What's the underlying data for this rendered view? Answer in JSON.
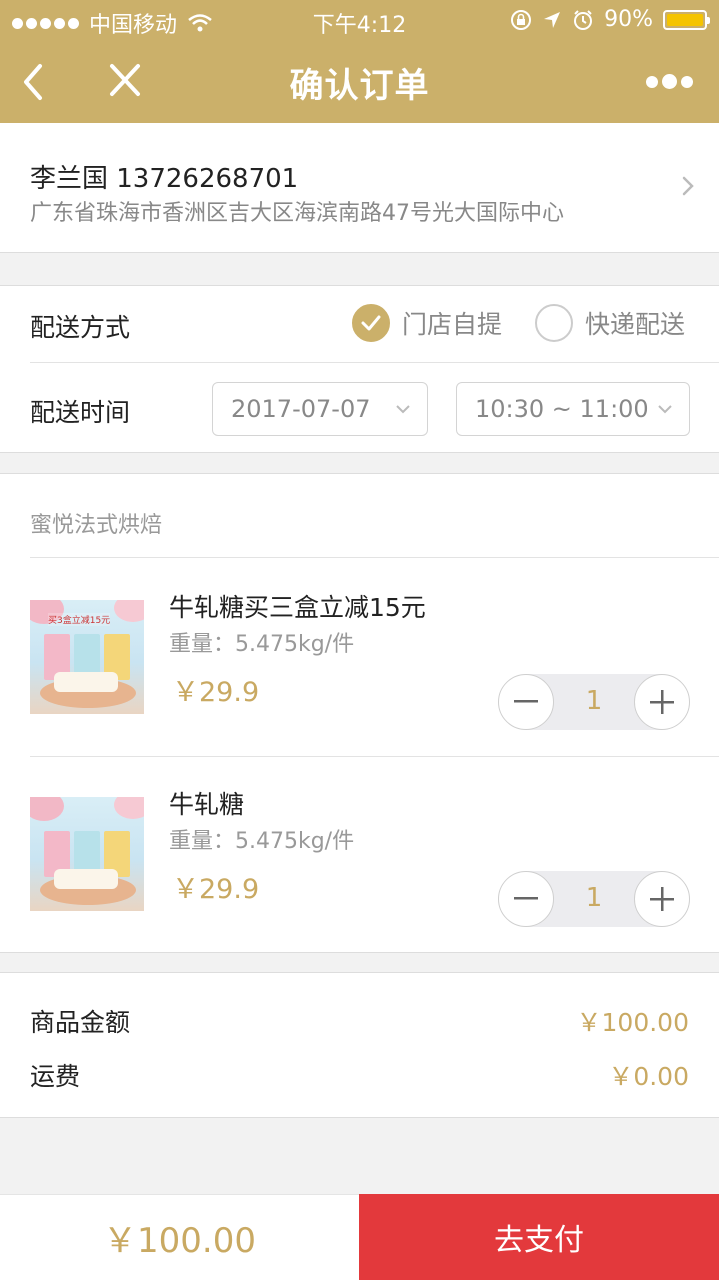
{
  "status_bar": {
    "carrier": "中国移动",
    "time": "下午4:12",
    "battery": "90%"
  },
  "nav": {
    "title": "确认订单",
    "back_icon": "back-chevron-icon",
    "close_icon": "close-icon",
    "more_icon": "more-dots-icon"
  },
  "address": {
    "name_phone": "李兰国 13726268701",
    "detail": "广东省珠海市香洲区吉大区海滨南路47号光大国际中心"
  },
  "delivery": {
    "method_label": "配送方式",
    "options": [
      "门店自提",
      "快递配送"
    ],
    "selected_option": "门店自提",
    "time_label": "配送时间",
    "date": "2017-07-07",
    "time_slot": "10:30 ~ 11:00"
  },
  "shop": {
    "name": "蜜悦法式烘焙"
  },
  "items": [
    {
      "title": "牛轧糖买三盒立减15元",
      "spec": "重量：5.475kg/件",
      "price": "￥29.9",
      "qty": "1",
      "thumb_promo": "买3盒立减15元"
    },
    {
      "title": "牛轧糖",
      "spec": "重量：5.475kg/件",
      "price": "￥29.9",
      "qty": "1",
      "thumb_promo": ""
    }
  ],
  "amounts": {
    "goods_label": "商品金额",
    "goods_value": "￥100.00",
    "shipping_label": "运费",
    "shipping_value": "￥0.00"
  },
  "footer": {
    "total": "￥100.00",
    "pay_label": "去支付"
  },
  "colors": {
    "brand_gold": "#cbb06a",
    "price_gold": "#c9a962",
    "pay_red": "#e3393c"
  }
}
